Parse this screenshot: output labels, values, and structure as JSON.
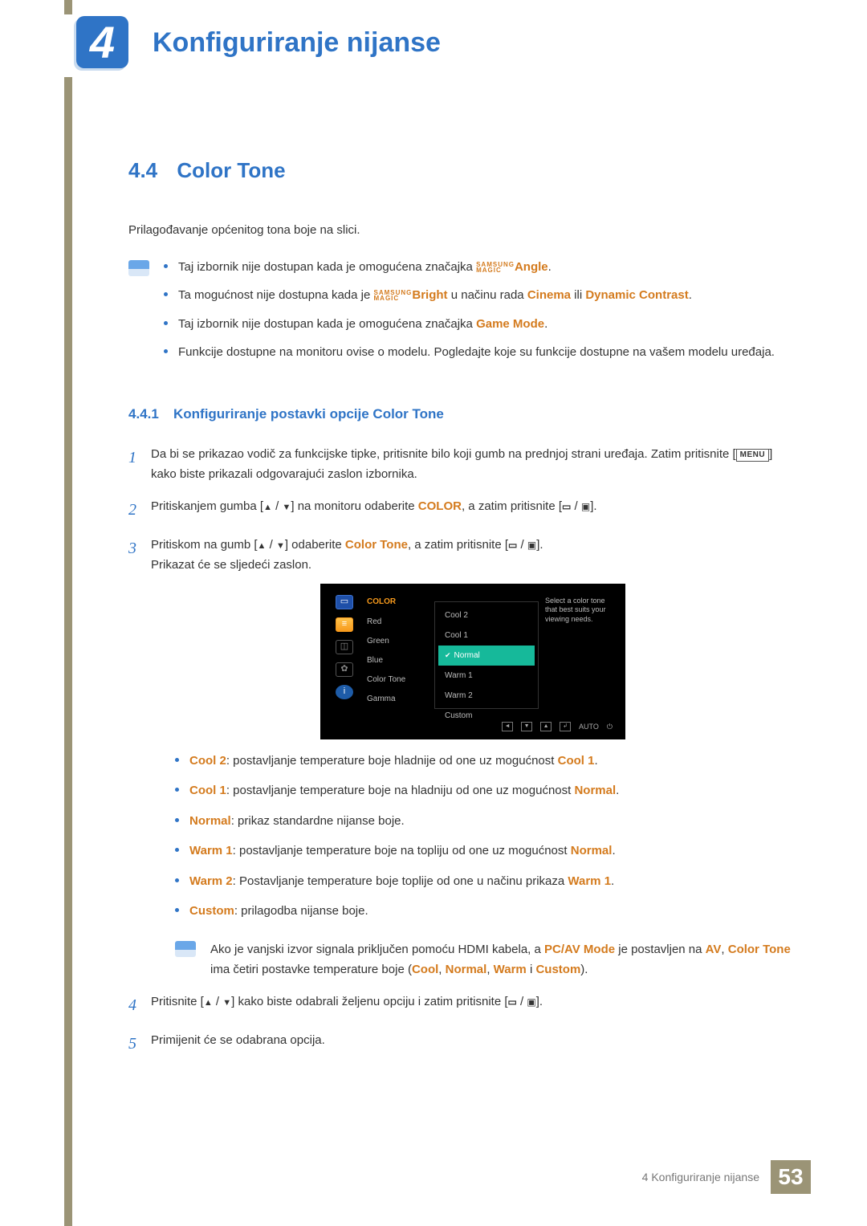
{
  "chapter": {
    "number": "4",
    "title": "Konfiguriranje nijanse"
  },
  "section": {
    "number": "4.4",
    "title": "Color Tone"
  },
  "intro": "Prilagođavanje općenitog tona boje na slici.",
  "magic": {
    "top": "SAMSUNG",
    "bottom": "MAGIC"
  },
  "notes": {
    "n1a": "Taj izbornik nije dostupan kada je omogućena značajka ",
    "n1b": "Angle",
    "n1c": ".",
    "n2a": "Ta mogućnost nije dostupna kada je ",
    "n2b": "Bright",
    "n2c": " u načinu rada ",
    "n2d": "Cinema",
    "n2e": " ili ",
    "n2f": "Dynamic Contrast",
    "n2g": ".",
    "n3a": "Taj izbornik nije dostupan kada je omogućena značajka ",
    "n3b": "Game Mode",
    "n3c": ".",
    "n4": "Funkcije dostupne na monitoru ovise o modelu. Pogledajte koje su funkcije dostupne na vašem modelu uređaja."
  },
  "subsection": {
    "number": "4.4.1",
    "title": "Konfiguriranje postavki opcije Color Tone"
  },
  "steps": {
    "s1a": "Da bi se prikazao vodič za funkcijske tipke, pritisnite bilo koji gumb na prednjoj strani uređaja. Zatim pritisnite [",
    "s1key": "MENU",
    "s1b": "] kako biste prikazali odgovarajući zaslon izbornika.",
    "s2a": "Pritiskanjem gumba [",
    "s2b": "] na monitoru odaberite ",
    "s2c": "COLOR",
    "s2d": ", a zatim pritisnite [",
    "s2e": "].",
    "s3a": "Pritiskom na gumb [",
    "s3b": "] odaberite ",
    "s3c": "Color Tone",
    "s3d": ", a zatim pritisnite [",
    "s3e": "].",
    "s3f": "Prikazat će se sljedeći zaslon.",
    "s4a": "Pritisnite [",
    "s4b": "] kako biste odabrali željenu opciju i zatim pritisnite [",
    "s4c": "].",
    "s5": "Primijenit će se odabrana opcija."
  },
  "osd": {
    "menu_header": "COLOR",
    "menu": [
      "Red",
      "Green",
      "Blue",
      "Color Tone",
      "Gamma"
    ],
    "options": [
      "Cool 2",
      "Cool 1",
      "Normal",
      "Warm 1",
      "Warm 2",
      "Custom"
    ],
    "selected": "Normal",
    "desc": "Select a color tone that best suits your viewing needs.",
    "nav_auto": "AUTO"
  },
  "descriptions": {
    "d1": {
      "label": "Cool 2",
      "text": ": postavljanje temperature boje hladnije od one uz mogućnost ",
      "ref": "Cool 1",
      "end": "."
    },
    "d2": {
      "label": "Cool 1",
      "text": ": postavljanje temperature boje na hladniju od one uz mogućnost ",
      "ref": "Normal",
      "end": "."
    },
    "d3": {
      "label": "Normal",
      "text": ": prikaz standardne nijanse boje."
    },
    "d4": {
      "label": "Warm 1",
      "text": ": postavljanje temperature boje na topliju od one uz mogućnost ",
      "ref": "Normal",
      "end": "."
    },
    "d5": {
      "label": "Warm 2",
      "text": ": Postavljanje temperature boje toplije od one u načinu prikaza ",
      "ref": "Warm 1",
      "end": "."
    },
    "d6": {
      "label": "Custom",
      "text": ": prilagodba nijanse boje."
    }
  },
  "hdmi_note": {
    "a": "Ako je vanjski izvor signala priključen pomoću HDMI kabela, a ",
    "b": "PC/AV Mode",
    "c": " je postavljen na ",
    "d": "AV",
    "e": ", ",
    "f": "Color Tone",
    "g": " ima četiri postavke temperature boje (",
    "h": "Cool",
    "i": ", ",
    "j": "Normal",
    "k": ", ",
    "l": "Warm",
    "m": " i ",
    "n": "Custom",
    "o": ")."
  },
  "footer": {
    "text": "4 Konfiguriranje nijanse",
    "page": "53"
  }
}
